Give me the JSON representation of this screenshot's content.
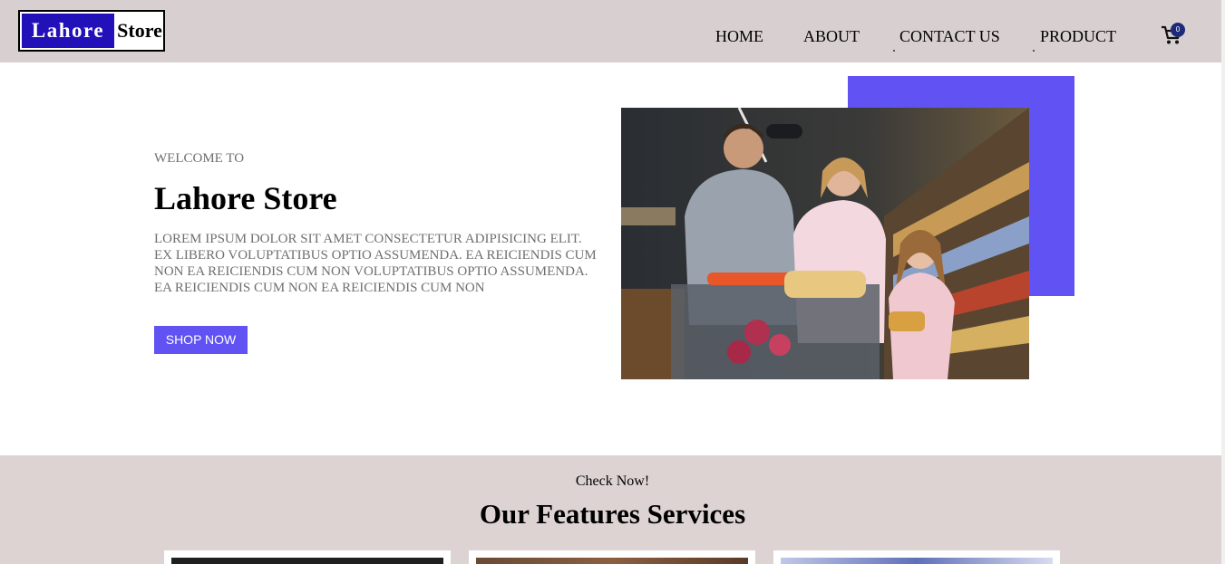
{
  "header": {
    "logo_part1": "Lahore",
    "logo_part2": "Store",
    "nav": {
      "home": "HOME",
      "about": "ABOUT",
      "contact": "CONTACT US",
      "product": "PRODUCT"
    },
    "cart_icon": "shopping-cart-icon",
    "cart_count": "0"
  },
  "hero": {
    "welcome": "WELCOME TO",
    "title": "Lahore Store",
    "description": "LOREM IPSUM DOLOR SIT AMET CONSECTETUR ADIPISICING ELIT. EX LIBERO VOLUPTATIBUS OPTIO ASSUMENDA. EA REICIENDIS CUM NON EA REICIENDIS CUM NON VOLUPTATIBUS OPTIO ASSUMENDA. EA REICIENDIS CUM NON EA REICIENDIS CUM NON",
    "button": "SHOP NOW",
    "image": "family-shopping-supermarket-photo"
  },
  "features": {
    "subtitle": "Check Now!",
    "title": "Our Features Services",
    "cards": [
      {
        "image": "feature-photo-dark"
      },
      {
        "image": "feature-photo-wood"
      },
      {
        "image": "feature-photo-blue"
      }
    ]
  },
  "colors": {
    "header_bg": "#d8d0d0",
    "logo_blue": "#2211b9",
    "accent": "#6152f3",
    "features_bg": "#ddd3d3",
    "muted_text": "#6f6f6f"
  }
}
